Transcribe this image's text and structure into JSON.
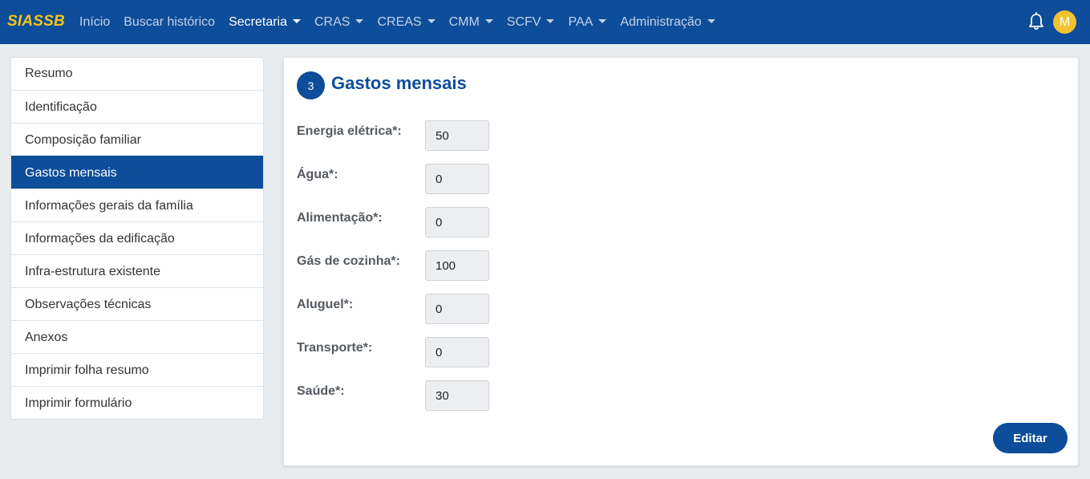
{
  "brand": "SIASSB",
  "nav": [
    {
      "label": "Início",
      "dropdown": false,
      "active": false
    },
    {
      "label": "Buscar histórico",
      "dropdown": false,
      "active": false
    },
    {
      "label": "Secretaria",
      "dropdown": true,
      "active": true
    },
    {
      "label": "CRAS",
      "dropdown": true,
      "active": false
    },
    {
      "label": "CREAS",
      "dropdown": true,
      "active": false
    },
    {
      "label": "CMM",
      "dropdown": true,
      "active": false
    },
    {
      "label": "SCFV",
      "dropdown": true,
      "active": false
    },
    {
      "label": "PAA",
      "dropdown": true,
      "active": false
    },
    {
      "label": "Administração",
      "dropdown": true,
      "active": false
    }
  ],
  "user": {
    "avatar_initial": "M",
    "avatar_color": "#f2c230"
  },
  "colors": {
    "primary": "#0d4d99",
    "brand_text": "#f5c518"
  },
  "sidebar": {
    "items": [
      {
        "label": "Resumo",
        "active": false
      },
      {
        "label": "Identificação",
        "active": false
      },
      {
        "label": "Composição familiar",
        "active": false
      },
      {
        "label": "Gastos mensais",
        "active": true
      },
      {
        "label": "Informações gerais da família",
        "active": false
      },
      {
        "label": "Informações da edificação",
        "active": false
      },
      {
        "label": "Infra-estrutura existente",
        "active": false
      },
      {
        "label": "Observações técnicas",
        "active": false
      },
      {
        "label": "Anexos",
        "active": false
      },
      {
        "label": "Imprimir folha resumo",
        "active": false
      },
      {
        "label": "Imprimir formulário",
        "active": false
      }
    ]
  },
  "section": {
    "step": "3",
    "title": "Gastos mensais",
    "fields": [
      {
        "label": "Energia elétrica*:",
        "value": "50"
      },
      {
        "label": "Água*:",
        "value": "0"
      },
      {
        "label": "Alimentação*:",
        "value": "0"
      },
      {
        "label": "Gás de cozinha*:",
        "value": "100"
      },
      {
        "label": "Aluguel*:",
        "value": "0"
      },
      {
        "label": "Transporte*:",
        "value": "0"
      },
      {
        "label": "Saúde*:",
        "value": "30"
      }
    ],
    "edit_label": "Editar"
  }
}
